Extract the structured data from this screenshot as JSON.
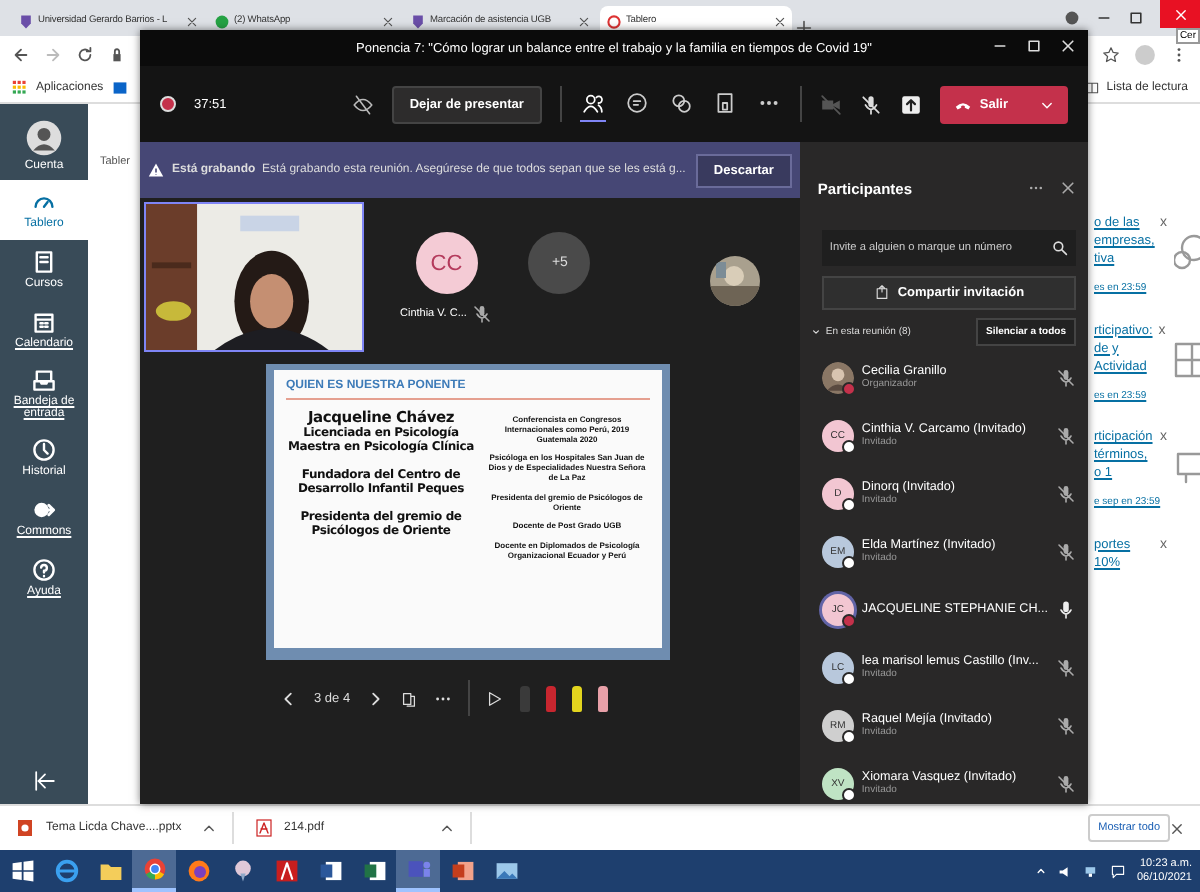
{
  "browser": {
    "tabs": [
      {
        "title": "Universidad Gerardo Barrios - L",
        "kind": "shield",
        "selected": false
      },
      {
        "title": "(2) WhatsApp",
        "kind": "chat",
        "selected": false
      },
      {
        "title": "Marcación de asistencia UGB",
        "kind": "shield",
        "selected": false
      },
      {
        "title": "Tablero",
        "kind": "ring",
        "selected": true
      }
    ],
    "tooltip": "Cer",
    "apps_label": "Aplicaciones",
    "reading_list": "Lista de lectura"
  },
  "lms": {
    "nav": [
      {
        "label": "Cuenta",
        "kind": "account",
        "selected": false,
        "underlined": false
      },
      {
        "label": "Tablero",
        "kind": "dashboard",
        "selected": true,
        "underlined": false
      },
      {
        "label": "Cursos",
        "kind": "courses",
        "selected": false,
        "underlined": false
      },
      {
        "label": "Calendario",
        "kind": "calendar",
        "selected": false,
        "underlined": true
      },
      {
        "label": "Bandeja de entrada",
        "kind": "inbox",
        "selected": false,
        "underlined": true
      },
      {
        "label": "Historial",
        "kind": "history",
        "selected": false,
        "underlined": false
      },
      {
        "label": "Commons",
        "kind": "commons",
        "selected": false,
        "underlined": true
      },
      {
        "label": "Ayuda",
        "kind": "help",
        "selected": false,
        "underlined": true
      }
    ],
    "breadcrumb": "Tabler",
    "todo": [
      {
        "lines": [
          "o de las",
          "empresas,",
          "tiva"
        ],
        "due": "es en 23:59",
        "close": "x",
        "kind": "people"
      },
      {
        "lines": [
          "rticipativo:",
          "de y",
          "Actividad"
        ],
        "due": "es en 23:59",
        "close": "x",
        "kind": "grid"
      },
      {
        "lines": [
          "rticipación",
          "términos,",
          "o 1"
        ],
        "due": "e sep en 23:59",
        "close": "x",
        "kind": "board"
      },
      {
        "lines": [
          "portes",
          "10%"
        ],
        "close": "x",
        "kind": "none"
      }
    ]
  },
  "teams": {
    "title": "Ponencia 7: \"Cómo lograr un balance entre el trabajo y la familia en tiempos de Covid 19\"",
    "timer": "37:51",
    "stop_presenting": "Dejar de presentar",
    "tools": [
      {
        "kind": "people",
        "selected": true
      },
      {
        "kind": "chat",
        "selected": false
      },
      {
        "kind": "reactions",
        "selected": false
      },
      {
        "kind": "rooms",
        "selected": false
      },
      {
        "kind": "more",
        "selected": false
      }
    ],
    "devices": [
      {
        "kind": "camera-off"
      },
      {
        "kind": "mic-off"
      },
      {
        "kind": "share"
      }
    ],
    "leave": "Salir",
    "banner": {
      "bold": "Está grabando",
      "message": "Está grabando esta reunión. Asegúrese de que todos sepan que se les está g...",
      "dismiss": "Descartar"
    },
    "tiles": {
      "initials": "CC",
      "name": "Cinthia V. C...",
      "overflow": "+5"
    },
    "slide": {
      "heading": "QUIEN ES NUESTRA PONENTE",
      "left": [
        [
          "Jacqueline Chávez",
          "Licenciada en Psicología",
          "Maestra en Psicología Clínica"
        ],
        [
          "Fundadora del Centro de",
          "Desarrollo Infantil Peques"
        ],
        [
          "Presidenta del gremio de",
          "Psicólogos de Oriente"
        ]
      ],
      "right": [
        "Conferencista en Congresos Internacionales como Perú, 2019 Guatemala 2020",
        "Psicóloga en los Hospitales San Juan de Dios y de Especialidades Nuestra Señora de La Paz",
        "Presidenta del gremio de Psicólogos de Oriente",
        "Docente de Post Grado UGB",
        "Docente en Diplomados de Psicología Organizacional Ecuador y Perú"
      ]
    },
    "page": "3 de 4",
    "pens": [
      {
        "color": "#3a3a3a"
      },
      {
        "color": "#c8262f"
      },
      {
        "color": "#e3d51e"
      },
      {
        "color": "#e8a0a8"
      }
    ],
    "panel": {
      "title": "Participantes",
      "placeholder": "Invite a alguien o marque un número",
      "share": "Compartir invitación",
      "section": "En esta reunión (8)",
      "mute_all": "Silenciar a todos",
      "people": [
        {
          "name": "Cecilia Granillo",
          "role": "Organizador",
          "color": "#8a7765",
          "busy": true,
          "speaking": false,
          "muted": true
        },
        {
          "name": "Cinthia V. Carcamo (Invitado)",
          "role": "Invitado",
          "kind": "initials",
          "initials": "CC",
          "color": "#f2c6d2",
          "busy": false,
          "speaking": false,
          "muted": true
        },
        {
          "name": "Dinorq (Invitado)",
          "role": "Invitado",
          "kind": "initials",
          "initials": "D",
          "color": "#f2c6d2",
          "busy": false,
          "speaking": false,
          "muted": true
        },
        {
          "name": "Elda Martínez (Invitado)",
          "role": "Invitado",
          "kind": "initials",
          "initials": "EM",
          "color": "#b8c8dc",
          "busy": false,
          "speaking": false,
          "muted": true
        },
        {
          "name": "JACQUELINE STEPHANIE CH...",
          "kind": "initials",
          "initials": "JC",
          "color": "#f2c6d2",
          "busy": true,
          "speaking": true,
          "muted": false
        },
        {
          "name": "lea marisol lemus Castillo (Inv...",
          "role": "Invitado",
          "kind": "initials",
          "initials": "LC",
          "color": "#b8c8dc",
          "busy": false,
          "speaking": false,
          "muted": true
        },
        {
          "name": "Raquel Mejía (Invitado)",
          "role": "Invitado",
          "kind": "initials",
          "initials": "RM",
          "color": "#cfcfcf",
          "busy": false,
          "speaking": false,
          "muted": true
        },
        {
          "name": "Xiomara Vasquez (Invitado)",
          "role": "Invitado",
          "kind": "initials",
          "initials": "XV",
          "color": "#bfe3c4",
          "busy": false,
          "speaking": false,
          "muted": true
        }
      ]
    }
  },
  "downloads": [
    {
      "name": "Tema Licda Chave....pptx",
      "kind": "pptx"
    },
    {
      "name": "214.pdf",
      "kind": "pdf"
    }
  ],
  "show_all": "Mostrar todo",
  "taskbar": {
    "apps": [
      {
        "kind": "start",
        "active": false
      },
      {
        "kind": "ie",
        "active": false
      },
      {
        "kind": "files",
        "active": false
      },
      {
        "kind": "chrome",
        "active": true
      },
      {
        "kind": "firefox",
        "active": false
      },
      {
        "kind": "paint",
        "active": false
      },
      {
        "kind": "acrobat",
        "active": false
      },
      {
        "kind": "word",
        "active": false
      },
      {
        "kind": "excel",
        "active": false
      },
      {
        "kind": "teams",
        "active": true
      },
      {
        "kind": "powerpoint",
        "active": false
      },
      {
        "kind": "photos",
        "active": false
      }
    ],
    "time": "10:23 a.m.",
    "date": "06/10/2021"
  }
}
